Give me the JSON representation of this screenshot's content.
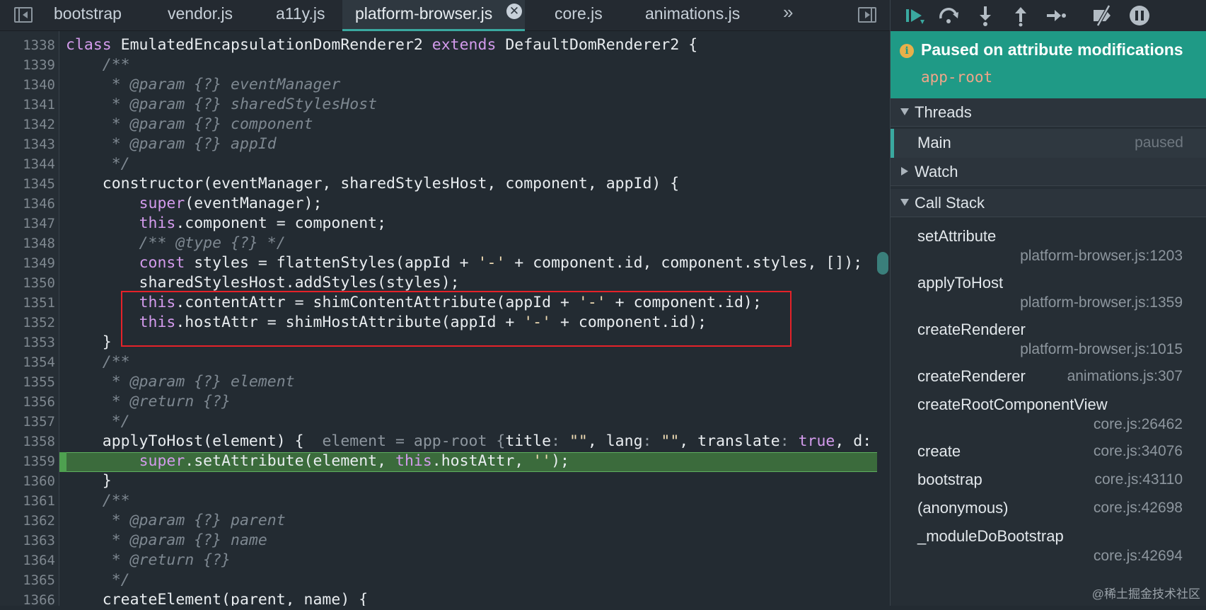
{
  "tabs": [
    {
      "label": "bootstrap"
    },
    {
      "label": "vendor.js"
    },
    {
      "label": "a11y.js"
    },
    {
      "label": "platform-browser.js",
      "active": true
    },
    {
      "label": "core.js"
    },
    {
      "label": "animations.js"
    }
  ],
  "tabs_overflow": "»",
  "tab_close_glyph": "✕",
  "lines": [
    {
      "n": "1338",
      "tokens": [
        {
          "t": "class ",
          "c": "kw"
        },
        {
          "t": "EmulatedEncapsulationDomRenderer2 "
        },
        {
          "t": "extends ",
          "c": "kw"
        },
        {
          "t": "DefaultDomRenderer2 {"
        }
      ]
    },
    {
      "n": "1339",
      "tokens": [
        {
          "t": "    /**",
          "c": "cm"
        }
      ]
    },
    {
      "n": "1340",
      "tokens": [
        {
          "t": "     * @param {?} eventManager",
          "c": "cm"
        }
      ]
    },
    {
      "n": "1341",
      "tokens": [
        {
          "t": "     * @param {?} sharedStylesHost",
          "c": "cm"
        }
      ]
    },
    {
      "n": "1342",
      "tokens": [
        {
          "t": "     * @param {?} component",
          "c": "cm"
        }
      ]
    },
    {
      "n": "1343",
      "tokens": [
        {
          "t": "     * @param {?} appId",
          "c": "cm"
        }
      ]
    },
    {
      "n": "1344",
      "tokens": [
        {
          "t": "     */",
          "c": "cm"
        }
      ]
    },
    {
      "n": "1345",
      "tokens": [
        {
          "t": "    constructor(eventManager, sharedStylesHost, component, appId) {"
        }
      ]
    },
    {
      "n": "1346",
      "tokens": [
        {
          "t": "        "
        },
        {
          "t": "super",
          "c": "kw"
        },
        {
          "t": "(eventManager);"
        }
      ]
    },
    {
      "n": "1347",
      "tokens": [
        {
          "t": "        "
        },
        {
          "t": "this",
          "c": "kw"
        },
        {
          "t": ".component = component;"
        }
      ]
    },
    {
      "n": "1348",
      "tokens": [
        {
          "t": "        /** @type {?} */",
          "c": "cm"
        }
      ]
    },
    {
      "n": "1349",
      "tokens": [
        {
          "t": "        "
        },
        {
          "t": "const ",
          "c": "kw"
        },
        {
          "t": "styles = flattenStyles(appId + "
        },
        {
          "t": "'-'",
          "c": "str"
        },
        {
          "t": " + component.id, component.styles, []);"
        }
      ]
    },
    {
      "n": "1350",
      "tokens": [
        {
          "t": "        sharedStylesHost.addStyles(styles);"
        }
      ]
    },
    {
      "n": "1351",
      "tokens": [
        {
          "t": "        "
        },
        {
          "t": "this",
          "c": "kw"
        },
        {
          "t": ".contentAttr = shimContentAttribute(appId + "
        },
        {
          "t": "'-'",
          "c": "str"
        },
        {
          "t": " + component.id);"
        }
      ]
    },
    {
      "n": "1352",
      "tokens": [
        {
          "t": "        "
        },
        {
          "t": "this",
          "c": "kw"
        },
        {
          "t": ".hostAttr = shimHostAttribute(appId + "
        },
        {
          "t": "'-'",
          "c": "str"
        },
        {
          "t": " + component.id);"
        }
      ]
    },
    {
      "n": "1353",
      "tokens": [
        {
          "t": "    }"
        }
      ]
    },
    {
      "n": "1354",
      "tokens": [
        {
          "t": "    /**",
          "c": "cm"
        }
      ]
    },
    {
      "n": "1355",
      "tokens": [
        {
          "t": "     * @param {?} element",
          "c": "cm"
        }
      ]
    },
    {
      "n": "1356",
      "tokens": [
        {
          "t": "     * @return {?}",
          "c": "cm"
        }
      ]
    },
    {
      "n": "1357",
      "tokens": [
        {
          "t": "     */",
          "c": "cm"
        }
      ]
    },
    {
      "n": "1358",
      "tokens": [
        {
          "t": "    applyToHost(element) {  "
        },
        {
          "t": "element = app-root {",
          "c": "dim"
        },
        {
          "t": "title"
        },
        {
          "t": ": ",
          "c": "dim"
        },
        {
          "t": "\"\"",
          "c": "str"
        },
        {
          "t": ", lang"
        },
        {
          "t": ": ",
          "c": "dim"
        },
        {
          "t": "\"\"",
          "c": "str"
        },
        {
          "t": ", translate"
        },
        {
          "t": ": ",
          "c": "dim"
        },
        {
          "t": "true",
          "c": "kw"
        },
        {
          "t": ", d:"
        }
      ]
    },
    {
      "n": "1359",
      "tokens": [
        {
          "t": "        "
        },
        {
          "t": "super",
          "c": "kw"
        },
        {
          "t": ".setAttribute(element, "
        },
        {
          "t": "this",
          "c": "kw"
        },
        {
          "t": ".hostAttr, "
        },
        {
          "t": "''",
          "c": "str"
        },
        {
          "t": ");"
        }
      ]
    },
    {
      "n": "1360",
      "tokens": [
        {
          "t": "    }"
        }
      ]
    },
    {
      "n": "1361",
      "tokens": [
        {
          "t": "    /**",
          "c": "cm"
        }
      ]
    },
    {
      "n": "1362",
      "tokens": [
        {
          "t": "     * @param {?} parent",
          "c": "cm"
        }
      ]
    },
    {
      "n": "1363",
      "tokens": [
        {
          "t": "     * @param {?} name",
          "c": "cm"
        }
      ]
    },
    {
      "n": "1364",
      "tokens": [
        {
          "t": "     * @return {?}",
          "c": "cm"
        }
      ]
    },
    {
      "n": "1365",
      "tokens": [
        {
          "t": "     */",
          "c": "cm"
        }
      ]
    },
    {
      "n": "1366",
      "tokens": [
        {
          "t": "    createElement(parent, name) {"
        }
      ]
    }
  ],
  "debugger": {
    "toolbar_icons": [
      "resume-icon",
      "step-over-icon",
      "step-into-icon",
      "step-out-icon",
      "step-icon",
      "deactivate-breakpoints-icon",
      "pause-on-exceptions-icon"
    ],
    "pause_title": "Paused on attribute modifications",
    "pause_target": "app-root",
    "threads_label": "Threads",
    "thread_main": "Main",
    "thread_status": "paused",
    "watch_label": "Watch",
    "callstack_label": "Call Stack",
    "frames": [
      {
        "fn": "setAttribute",
        "loc": "platform-browser.js:1203",
        "wrap": true
      },
      {
        "fn": "applyToHost",
        "loc": "platform-browser.js:1359",
        "wrap": true
      },
      {
        "fn": "createRenderer",
        "loc": "platform-browser.js:1015",
        "wrap": true
      },
      {
        "fn": "createRenderer",
        "loc": "animations.js:307",
        "wrap": false
      },
      {
        "fn": "createRootComponentView",
        "loc": "core.js:26462",
        "wrap": true
      },
      {
        "fn": "create",
        "loc": "core.js:34076",
        "wrap": false
      },
      {
        "fn": "bootstrap",
        "loc": "core.js:43110",
        "wrap": false
      },
      {
        "fn": "(anonymous)",
        "loc": "core.js:42698",
        "wrap": false
      },
      {
        "fn": "_moduleDoBootstrap",
        "loc": "core.js:42694",
        "wrap": true
      }
    ]
  },
  "watermark": "@稀土掘金技术社区",
  "colors": {
    "accent": "#3aa9a0",
    "banner": "#1f9a86",
    "keyword": "#d39bec",
    "highlight_box": "#e52229",
    "exec_line": "#3b6b3c"
  }
}
